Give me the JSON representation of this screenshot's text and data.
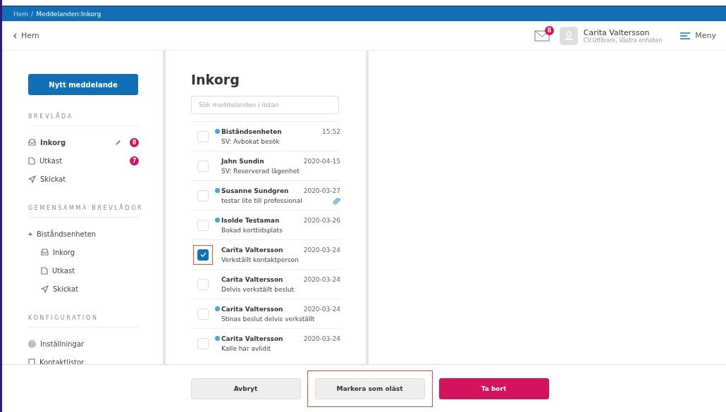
{
  "breadcrumb": {
    "home": "Hem",
    "separator": "/",
    "current": "Meddelanden:Inkorg"
  },
  "header": {
    "back": "Hem",
    "mail_badge": "8",
    "user_name": "Carita Valtersson",
    "user_role": "CV.Utförare, Västra enheten",
    "menu": "Meny"
  },
  "sidebar": {
    "new_button": "Nytt meddelande",
    "sections": [
      {
        "title": "BREVLÅDA",
        "items": [
          {
            "kind": "inbox",
            "label": "Inkorg",
            "selected": true,
            "editable": true,
            "badge": "8"
          },
          {
            "kind": "draft",
            "label": "Utkast",
            "selected": false,
            "editable": false,
            "badge": "7"
          },
          {
            "kind": "sent",
            "label": "Skickat",
            "selected": false,
            "editable": false
          }
        ]
      },
      {
        "title": "GEMENSAMMA BREVLÅDOR",
        "items": [
          {
            "kind": "group",
            "label": "Biståndsenheten",
            "selected": false,
            "editable": false,
            "expanded": true,
            "children": [
              {
                "kind": "inbox",
                "label": "Inkorg",
                "selected": false,
                "editable": false
              },
              {
                "kind": "draft",
                "label": "Utkast",
                "selected": false,
                "editable": false
              },
              {
                "kind": "sent",
                "label": "Skickat",
                "selected": false,
                "editable": false
              }
            ]
          }
        ]
      },
      {
        "title": "KONFIGURATION",
        "items": [
          {
            "kind": "settings",
            "label": "Inställningar",
            "selected": false,
            "editable": false
          },
          {
            "kind": "contacts",
            "label": "Kontaktlistor",
            "selected": false,
            "editable": false
          }
        ]
      }
    ]
  },
  "inbox": {
    "title": "Inkorg",
    "search": {
      "placeholder": "Sök meddelanden i listan"
    },
    "messages": [
      {
        "sender": "Biståndsenheten",
        "date": "15:52",
        "subject": "SV: Avbokat besök",
        "unread": true,
        "checked": false,
        "attachment": false,
        "highlighted": false
      },
      {
        "sender": "Jahn Sundin",
        "date": "2020-04-15",
        "subject": "SV: Reserverad lägenhet",
        "unread": false,
        "checked": false,
        "attachment": false,
        "highlighted": false
      },
      {
        "sender": "Susanne Sundgren",
        "date": "2020-03-27",
        "subject": "testar lite till professional",
        "unread": true,
        "checked": false,
        "attachment": true,
        "highlighted": false
      },
      {
        "sender": "Isolde Testaman",
        "date": "2020-03-26",
        "subject": "Bokad korttidsplats",
        "unread": true,
        "checked": false,
        "attachment": false,
        "highlighted": false
      },
      {
        "sender": "Carita Valtersson",
        "date": "2020-03-24",
        "subject": "Verkställt kontaktperson",
        "unread": false,
        "checked": true,
        "attachment": false,
        "highlighted": true
      },
      {
        "sender": "Carita Valtersson",
        "date": "2020-03-24",
        "subject": "Delvis verkställt beslut",
        "unread": false,
        "checked": false,
        "attachment": false,
        "highlighted": false
      },
      {
        "sender": "Carita Valtersson",
        "date": "2020-03-24",
        "subject": "Stinas beslut delvis verkställt",
        "unread": true,
        "checked": false,
        "attachment": false,
        "highlighted": false
      },
      {
        "sender": "Carita Valtersson",
        "date": "2020-03-24",
        "subject": "Kalle har avlidit",
        "unread": true,
        "checked": false,
        "attachment": false,
        "highlighted": false
      }
    ]
  },
  "footer": {
    "buttons": [
      {
        "kind": "secondary",
        "label": "Avbryt",
        "highlighted": false
      },
      {
        "kind": "secondary",
        "label": "Markera som oläst",
        "highlighted": true
      },
      {
        "kind": "danger",
        "label": "Ta bort",
        "highlighted": false
      }
    ]
  }
}
